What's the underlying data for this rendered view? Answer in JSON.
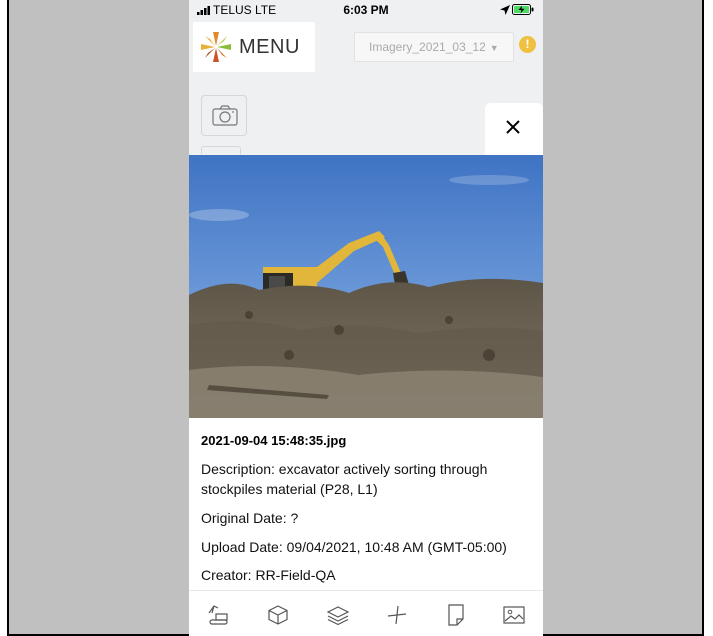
{
  "status_bar": {
    "carrier": "TELUS  LTE",
    "time": "6:03 PM"
  },
  "header": {
    "menu_label": "MENU",
    "imagery_select_value": "Imagery_2021_03_12",
    "alert_symbol": "!"
  },
  "photo_details": {
    "filename": "2021-09-04 15:48:35.jpg",
    "description": "Description: excavator actively sorting through stockpiles material (P28, L1)",
    "original_date": "Original Date: ?",
    "upload_date": "Upload Date: 09/04/2021, 10:48 AM (GMT-05:00)",
    "creator": "Creator: RR-Field-QA"
  },
  "toolbar_icons": [
    "excavator-icon",
    "box-3d-icon",
    "layers-icon",
    "measure-icon",
    "document-icon",
    "image-icon"
  ],
  "colors": {
    "accent_yellow": "#f0c040",
    "sky_blue": "#4a7fcc",
    "dirt_brown": "#6d6252"
  }
}
